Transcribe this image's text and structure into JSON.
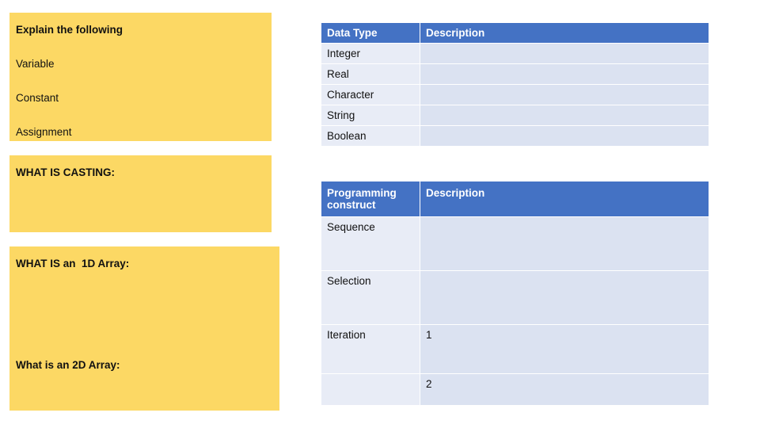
{
  "notes": {
    "box1": {
      "lines": [
        {
          "text": "Explain the following",
          "bold": true
        },
        {
          "text": "Variable",
          "bold": false
        },
        {
          "text": "Constant",
          "bold": false
        },
        {
          "text": "Assignment",
          "bold": false
        }
      ]
    },
    "box2": {
      "title": "WHAT IS CASTING:"
    },
    "box3": {
      "title": "WHAT IS an  1D Array:"
    },
    "box4": {
      "title": "What is an 2D Array:"
    }
  },
  "datatype_table": {
    "headers": [
      "Data Type",
      "Description"
    ],
    "rows": [
      {
        "type": "Integer",
        "description": ""
      },
      {
        "type": "Real",
        "description": ""
      },
      {
        "type": "Character",
        "description": ""
      },
      {
        "type": "String",
        "description": ""
      },
      {
        "type": "Boolean",
        "description": ""
      }
    ]
  },
  "construct_table": {
    "headers": [
      "Programming construct",
      "Description"
    ],
    "rows": [
      {
        "construct": "Sequence",
        "description": ""
      },
      {
        "construct": "Selection",
        "description": ""
      },
      {
        "construct": "Iteration",
        "description": "1"
      },
      {
        "construct": "",
        "description": "2"
      }
    ]
  },
  "colors": {
    "note_yellow": "#fcd864",
    "header_blue": "#4472c4",
    "cell_blue": "#dbe2f1",
    "cell_light": "#e8ecf6"
  }
}
